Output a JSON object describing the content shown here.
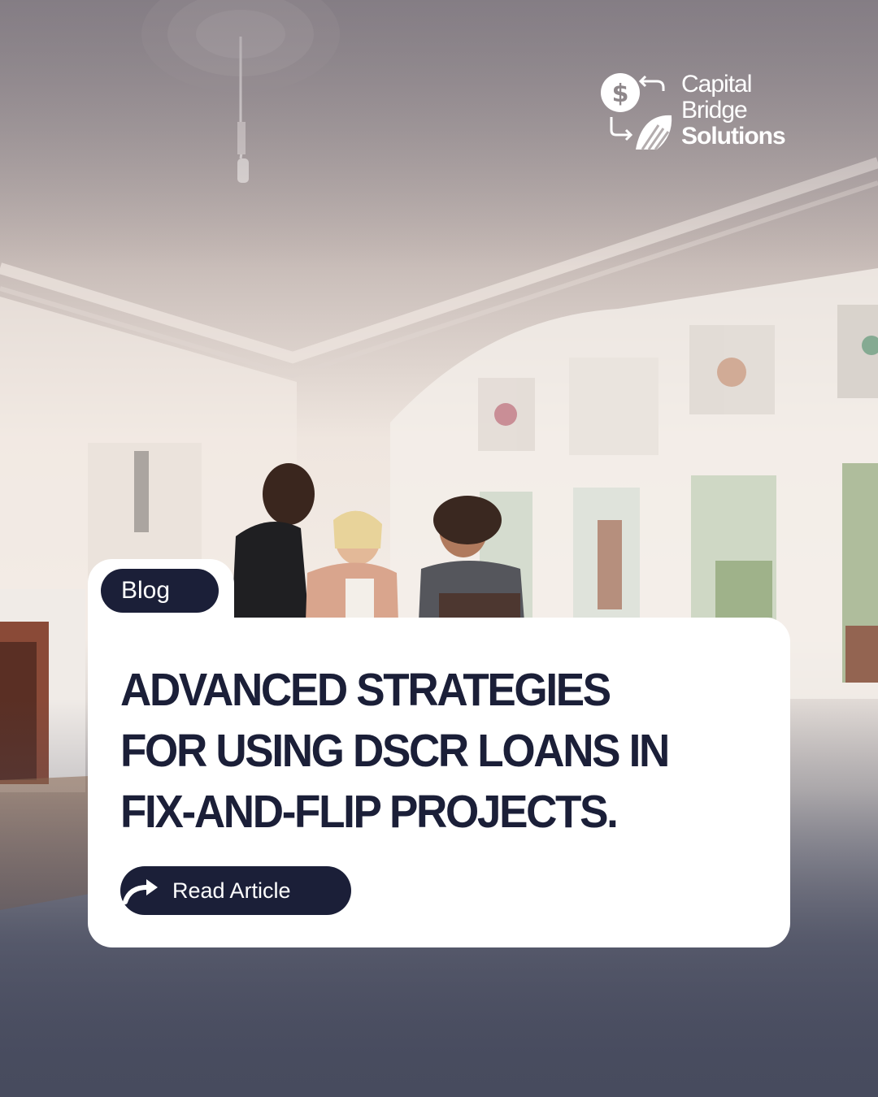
{
  "brand": {
    "line1": "Capital",
    "line2": "Bridge",
    "line3": "Solutions",
    "logo_icon": "dollar-coin-exchange-icon",
    "colors": {
      "navy": "#1b1f38",
      "white": "#ffffff"
    }
  },
  "tag": {
    "label": "Blog"
  },
  "headline": {
    "line1": "ADVANCED STRATEGIES",
    "line2": "FOR USING DSCR LOANS IN",
    "line3": "FIX-AND-FLIP PROJECTS."
  },
  "cta": {
    "label": "Read Article",
    "icon": "curved-arrow-right-icon"
  }
}
